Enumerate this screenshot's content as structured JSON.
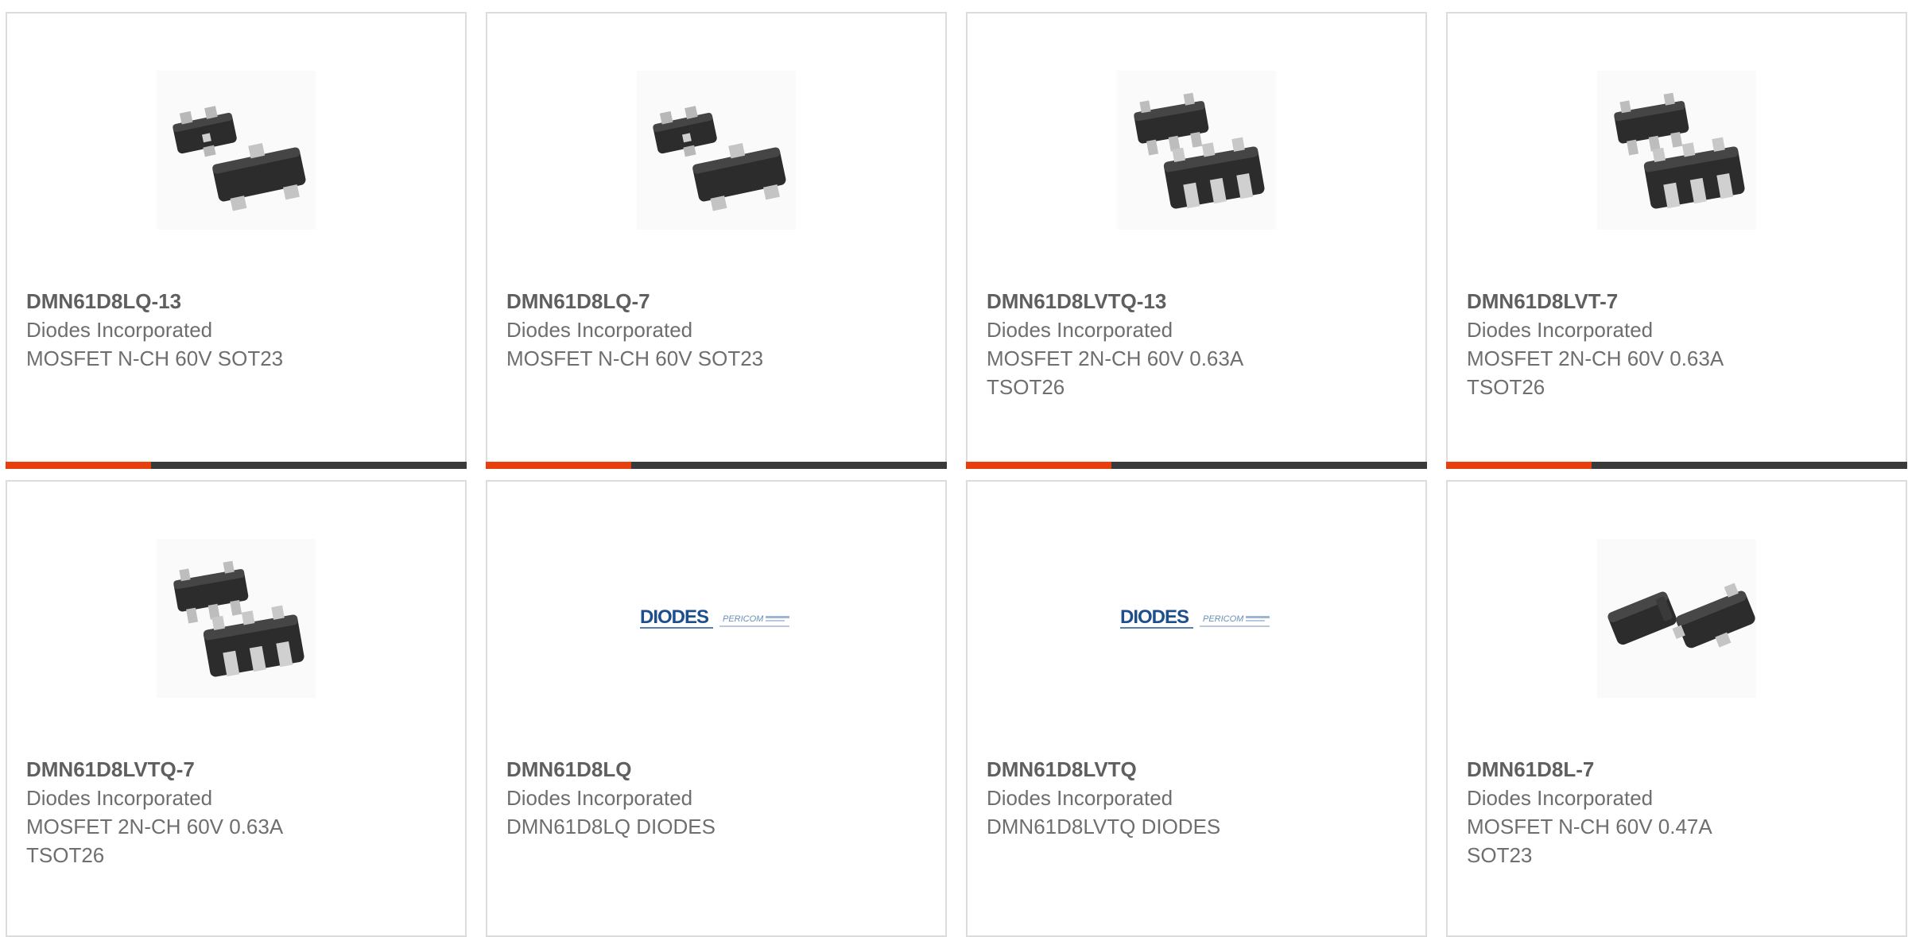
{
  "colors": {
    "accent": "#e8400c",
    "bar": "#3a3a3a",
    "border": "#dcdcdc",
    "part_text": "#5f5f5f",
    "body_text": "#6e6e6e"
  },
  "cards": [
    {
      "part": "DMN61D8LQ-13",
      "manufacturer": "Diodes Incorporated",
      "description": "MOSFET N-CH 60V SOT23",
      "image": "sot23-package-image",
      "accent_bar": true
    },
    {
      "part": "DMN61D8LQ-7",
      "manufacturer": "Diodes Incorporated",
      "description": "MOSFET N-CH 60V SOT23",
      "image": "sot23-package-image",
      "accent_bar": true
    },
    {
      "part": "DMN61D8LVTQ-13",
      "manufacturer": "Diodes Incorporated",
      "description": "MOSFET 2N-CH 60V 0.63A TSOT26",
      "image": "tsot26-package-image",
      "accent_bar": true
    },
    {
      "part": "DMN61D8LVT-7",
      "manufacturer": "Diodes Incorporated",
      "description": "MOSFET 2N-CH 60V 0.63A TSOT26",
      "image": "tsot26-package-image",
      "accent_bar": true
    },
    {
      "part": "DMN61D8LVTQ-7",
      "manufacturer": "Diodes Incorporated",
      "description": "MOSFET 2N-CH 60V 0.63A TSOT26",
      "image": "tsot26-package-image",
      "accent_bar": false
    },
    {
      "part": "DMN61D8LQ",
      "manufacturer": "Diodes Incorporated",
      "description": "DMN61D8LQ DIODES",
      "image": "diodes-pericom-logo",
      "logo_text": "DIODES",
      "logo_sub": "PERICOM",
      "accent_bar": false
    },
    {
      "part": "DMN61D8LVTQ",
      "manufacturer": "Diodes Incorporated",
      "description": "DMN61D8LVTQ DIODES",
      "image": "diodes-pericom-logo",
      "logo_text": "DIODES",
      "logo_sub": "PERICOM",
      "accent_bar": false
    },
    {
      "part": "DMN61D8L-7",
      "manufacturer": "Diodes Incorporated",
      "description": "MOSFET N-CH 60V 0.47A SOT23",
      "image": "sot23-package-image",
      "accent_bar": false
    }
  ]
}
